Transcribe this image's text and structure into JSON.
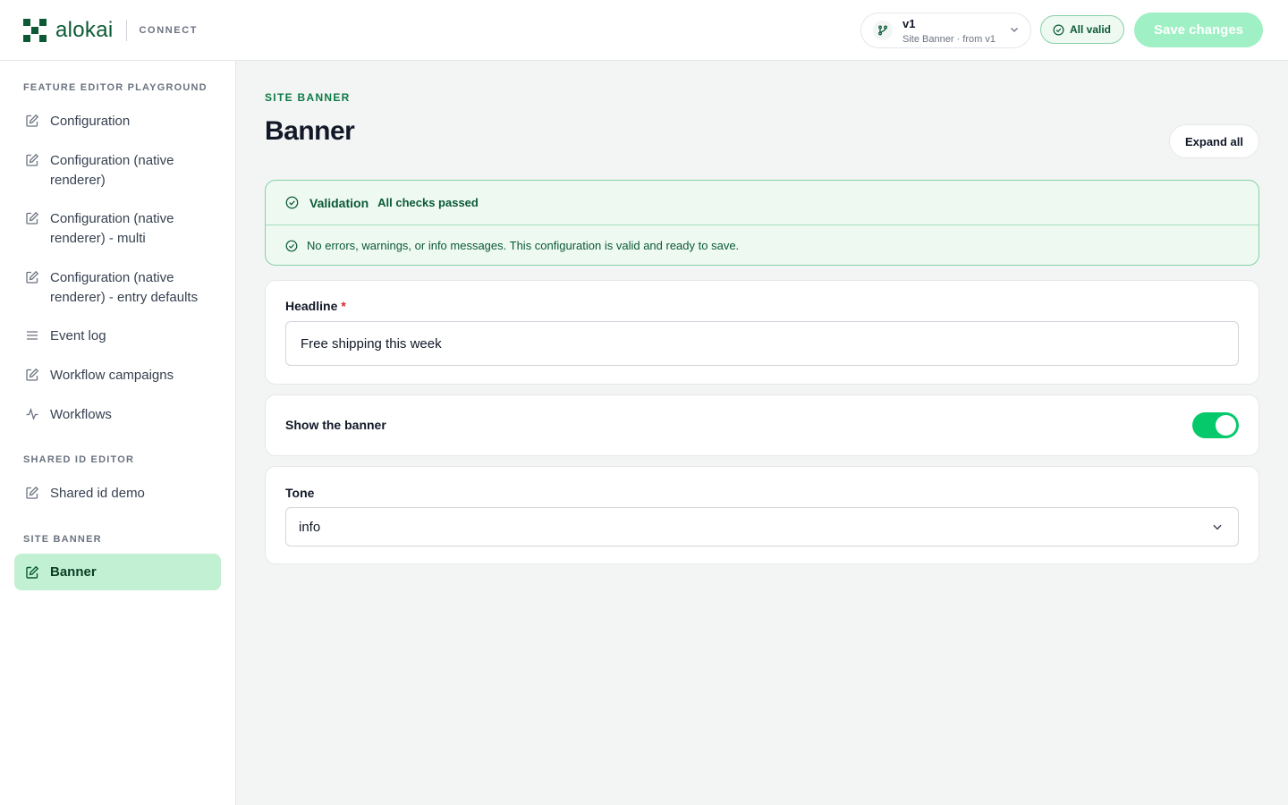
{
  "header": {
    "brand_name": "alokai",
    "brand_product": "CONNECT",
    "version": {
      "title": "v1",
      "subtitle": "Site Banner · from v1",
      "icon": "git-branch-icon"
    },
    "status_badge": "All valid",
    "save_label": "Save changes"
  },
  "sidebar": {
    "sections": [
      {
        "title": "FEATURE EDITOR PLAYGROUND",
        "items": [
          {
            "label": "Configuration",
            "icon": "edit-icon"
          },
          {
            "label": "Configuration (native renderer)",
            "icon": "edit-icon"
          },
          {
            "label": "Configuration (native renderer) - multi",
            "icon": "edit-icon"
          },
          {
            "label": "Configuration (native renderer) - entry defaults",
            "icon": "edit-icon"
          },
          {
            "label": "Event log",
            "icon": "list-icon"
          },
          {
            "label": "Workflow campaigns",
            "icon": "edit-icon"
          },
          {
            "label": "Workflows",
            "icon": "activity-icon"
          }
        ]
      },
      {
        "title": "SHARED ID EDITOR",
        "items": [
          {
            "label": "Shared id demo",
            "icon": "edit-icon"
          }
        ]
      },
      {
        "title": "SITE BANNER",
        "items": [
          {
            "label": "Banner",
            "icon": "edit-icon",
            "active": true
          }
        ]
      }
    ]
  },
  "main": {
    "eyebrow": "SITE BANNER",
    "title": "Banner",
    "expand_label": "Expand all",
    "validation": {
      "title": "Validation",
      "summary": "All checks passed",
      "message": "No errors, warnings, or info messages. This configuration is valid and ready to save."
    },
    "fields": {
      "headline": {
        "label": "Headline",
        "required_mark": "*",
        "value": "Free shipping this week"
      },
      "show_banner": {
        "label": "Show the banner",
        "on": true
      },
      "tone": {
        "label": "Tone",
        "value": "info"
      }
    }
  },
  "colors": {
    "brand_green": "#0b5a35",
    "accent_green": "#06c96b",
    "active_nav_bg": "#c2f0d3",
    "save_button_bg": "#9ff0c4"
  }
}
